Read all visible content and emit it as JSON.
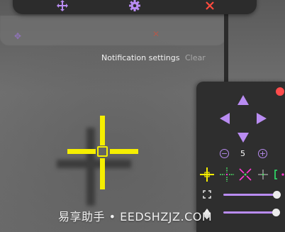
{
  "top_toolbar": {
    "items": [
      {
        "icon": "move-arrows-icon",
        "color": "#b98cf2"
      },
      {
        "icon": "gear-icon",
        "color": "#b98cf2"
      },
      {
        "icon": "close-icon",
        "color": "#ff4b3e"
      }
    ]
  },
  "notification": {
    "settings_label": "Notification settings",
    "clear_label": "Clear"
  },
  "crosshair": {
    "color": "#f5ee00"
  },
  "control_panel": {
    "accent": "#b98cf2",
    "record_dot_color": "#ff4c4c",
    "size_value": "5",
    "minus_label": "−",
    "plus_label": "+",
    "crosshair_styles": [
      {
        "icon": "crosshair-style-yellow-icon",
        "color": "#f5ee00"
      },
      {
        "icon": "crosshair-style-green-icon",
        "color": "#4cd964"
      },
      {
        "icon": "crosshair-style-x-icon",
        "color": "#ff3ad2"
      },
      {
        "icon": "crosshair-style-thin-icon",
        "color": "#cfcfcf"
      },
      {
        "icon": "crosshair-style-bracket-icon",
        "color": "#2ee66b"
      }
    ],
    "sliders": [
      {
        "icon": "expand-icon",
        "level": 1.0
      },
      {
        "icon": "opacity-drop-icon",
        "level": 0.97
      }
    ]
  },
  "watermark": "易享助手 • EEDSHZJZ.COM"
}
